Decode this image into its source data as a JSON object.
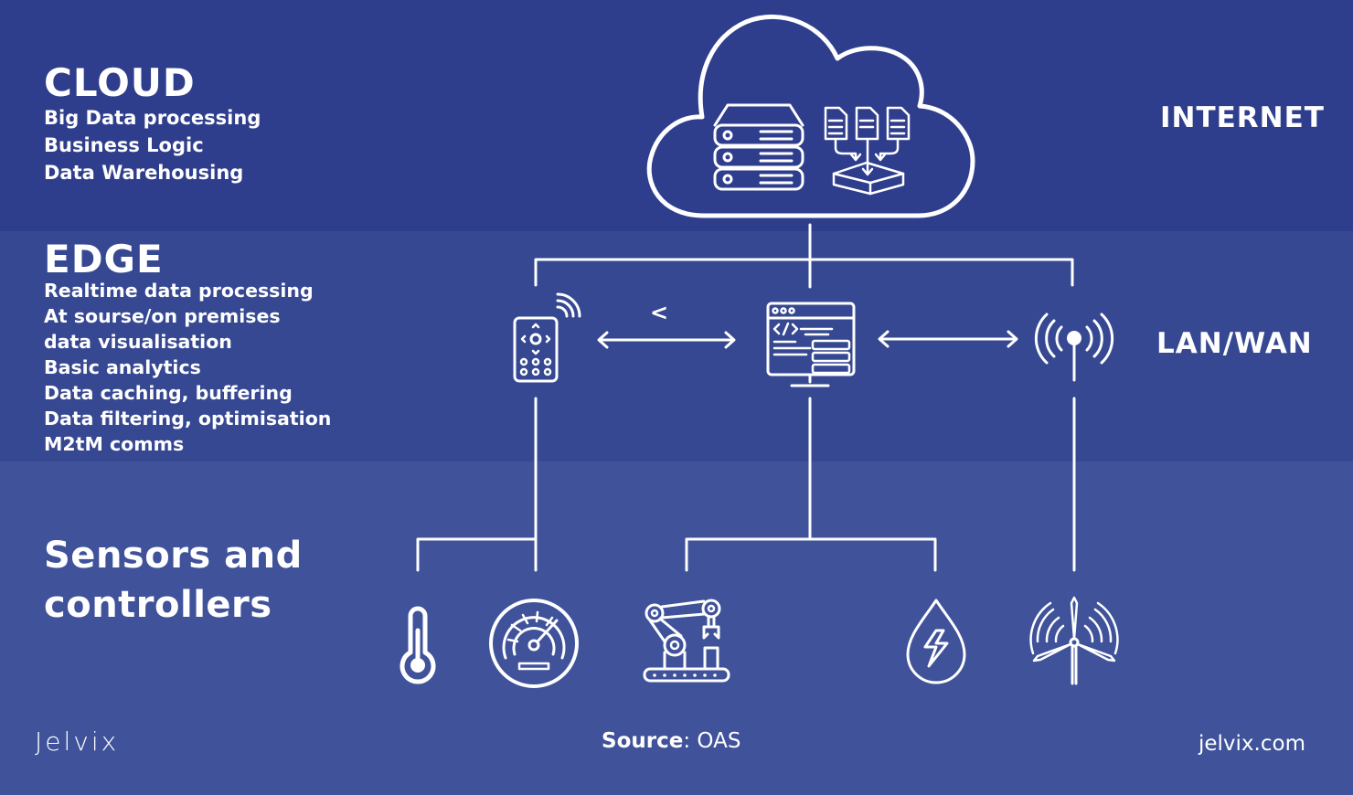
{
  "colors": {
    "cloud_band": "#2f3e8c",
    "edge_band": "#364892",
    "sensors_band": "#3f529a",
    "foreground": "#ffffff"
  },
  "cloud": {
    "title": "CLOUD",
    "items": [
      "Big Data processing",
      "Business Logic",
      "Data Warehousing"
    ],
    "zone_label": "INTERNET",
    "icons": [
      "cloud-icon",
      "server-stack-icon",
      "data-warehouse-icon"
    ]
  },
  "edge": {
    "title": "EDGE",
    "items": [
      "Realtime data processing",
      "At sourse/on premises",
      "data visualisation",
      "Basic analytics",
      "Data caching, buffering",
      "Data filtering, optimisation",
      "M2tM comms"
    ],
    "zone_label": "LAN/WAN",
    "stray_glyph": "<",
    "icons": [
      "remote-control-icon",
      "edge-computer-icon",
      "antenna-icon"
    ]
  },
  "sensors": {
    "title_line1": "Sensors and",
    "title_line2": "controllers",
    "icons": [
      "thermometer-icon",
      "speedometer-icon",
      "robotic-arm-icon",
      "water-energy-icon",
      "wind-turbine-icon"
    ]
  },
  "footer": {
    "logo": "Jelvix",
    "source_label": "Source",
    "source_sep": ": ",
    "source_value": "OAS",
    "website": "jelvix.com"
  }
}
